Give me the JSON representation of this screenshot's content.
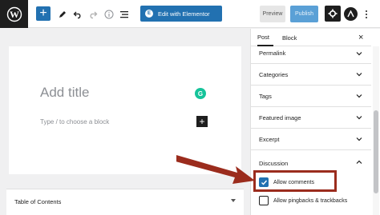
{
  "toolbar": {
    "elementor_label": "Edit with Elementor",
    "elementor_badge": "E",
    "preview_label": "Preview",
    "publish_label": "Publish",
    "add_symbol": "+"
  },
  "editor": {
    "title_placeholder": "Add title",
    "block_placeholder": "Type / to choose a block",
    "grammarly_letter": "G",
    "inserter_symbol": "+",
    "toc_label": "Table of Contents"
  },
  "sidebar": {
    "tabs": [
      {
        "label": "Post"
      },
      {
        "label": "Block"
      }
    ],
    "close_symbol": "×",
    "panels": [
      {
        "label": "Permalink"
      },
      {
        "label": "Categories"
      },
      {
        "label": "Tags"
      },
      {
        "label": "Featured image"
      },
      {
        "label": "Excerpt"
      }
    ],
    "discussion": {
      "label": "Discussion",
      "options": [
        {
          "label": "Allow comments",
          "checked": true
        },
        {
          "label": "Allow pingbacks & trackbacks",
          "checked": false
        }
      ]
    }
  },
  "colors": {
    "accent": "#2271b1",
    "highlight": "#9b2c1d",
    "grammarly": "#15c39a"
  }
}
